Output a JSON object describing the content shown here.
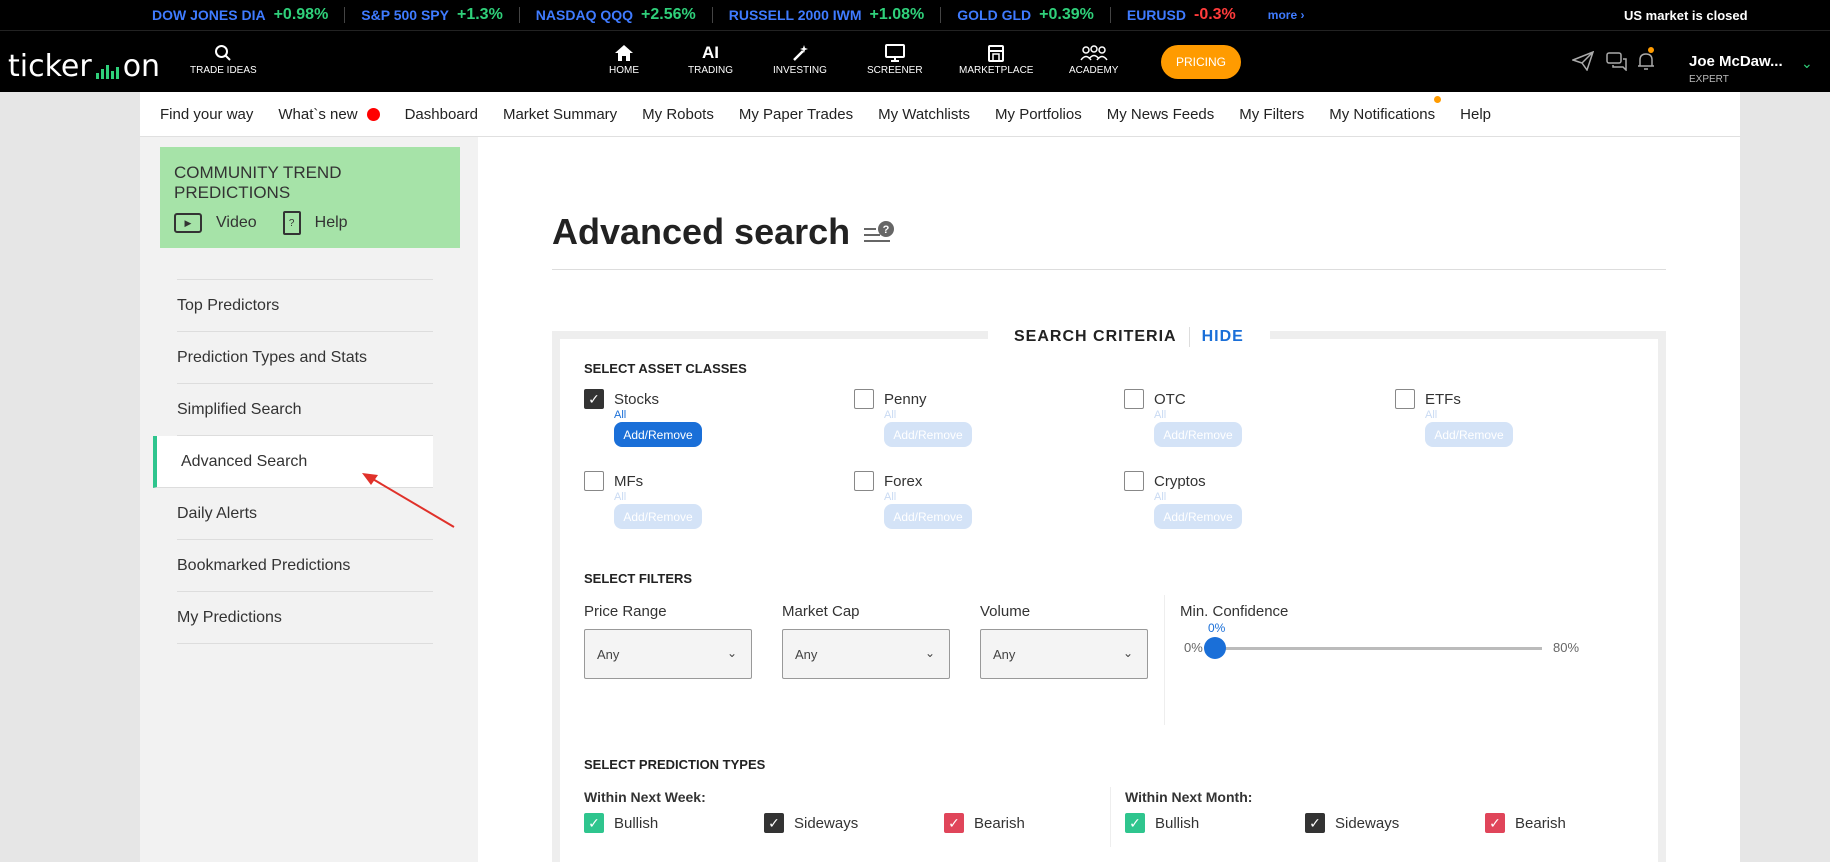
{
  "ticker": {
    "items": [
      {
        "name": "DOW JONES DIA",
        "change": "+0.98%",
        "dir": "pos"
      },
      {
        "name": "S&P 500 SPY",
        "change": "+1.3%",
        "dir": "pos"
      },
      {
        "name": "NASDAQ QQQ",
        "change": "+2.56%",
        "dir": "pos"
      },
      {
        "name": "RUSSELL 2000 IWM",
        "change": "+1.08%",
        "dir": "pos"
      },
      {
        "name": "GOLD GLD",
        "change": "+0.39%",
        "dir": "pos"
      },
      {
        "name": "EURUSD",
        "change": "-0.3%",
        "dir": "neg"
      }
    ],
    "more": "more ›",
    "market_status": "US market is closed"
  },
  "mainnav": {
    "logo_left": "ticker",
    "logo_right": "on",
    "trade_ideas": "TRADE IDEAS",
    "home": "HOME",
    "ai": "AI",
    "trading": "TRADING",
    "investing": "INVESTING",
    "screener": "SCREENER",
    "marketplace": "MARKETPLACE",
    "academy": "ACADEMY",
    "pricing": "PRICING",
    "user_name": "Joe McDaw...",
    "user_role": "EXPERT"
  },
  "subnav": {
    "items": [
      "Find your way",
      "What`s new",
      "Dashboard",
      "Market Summary",
      "My Robots",
      "My Paper Trades",
      "My Watchlists",
      "My Portfolios",
      "My News Feeds",
      "My Filters",
      "My Notifications",
      "Help"
    ]
  },
  "sidebar": {
    "promo_title": "COMMUNITY TREND PREDICTIONS",
    "video": "Video",
    "help": "Help",
    "items": [
      "Top Predictors",
      "Prediction Types and Stats",
      "Simplified Search",
      "Advanced Search",
      "Daily Alerts",
      "Bookmarked Predictions",
      "My Predictions"
    ],
    "active": "Advanced Search"
  },
  "main": {
    "title": "Advanced search",
    "criteria_label": "SEARCH CRITERIA",
    "hide_label": "HIDE",
    "asset_section": "SELECT ASSET CLASSES",
    "assets": [
      {
        "label": "Stocks",
        "checked": true
      },
      {
        "label": "Penny",
        "checked": false
      },
      {
        "label": "OTC",
        "checked": false
      },
      {
        "label": "ETFs",
        "checked": false
      },
      {
        "label": "MFs",
        "checked": false
      },
      {
        "label": "Forex",
        "checked": false
      },
      {
        "label": "Cryptos",
        "checked": false
      }
    ],
    "all_label": "All",
    "add_remove_label": "Add/Remove",
    "filters_section": "SELECT FILTERS",
    "price_range": {
      "label": "Price Range",
      "value": "Any"
    },
    "market_cap": {
      "label": "Market Cap",
      "value": "Any"
    },
    "volume": {
      "label": "Volume",
      "value": "Any"
    },
    "min_confidence": {
      "label": "Min. Confidence",
      "value": "0%",
      "min": "0%",
      "max": "80%"
    },
    "prediction_section": "SELECT PREDICTION TYPES",
    "next_week": {
      "label": "Within Next Week:",
      "bullish": "Bullish",
      "sideways": "Sideways",
      "bearish": "Bearish"
    },
    "next_month": {
      "label": "Within Next Month:",
      "bullish": "Bullish",
      "sideways": "Sideways",
      "bearish": "Bearish"
    }
  }
}
